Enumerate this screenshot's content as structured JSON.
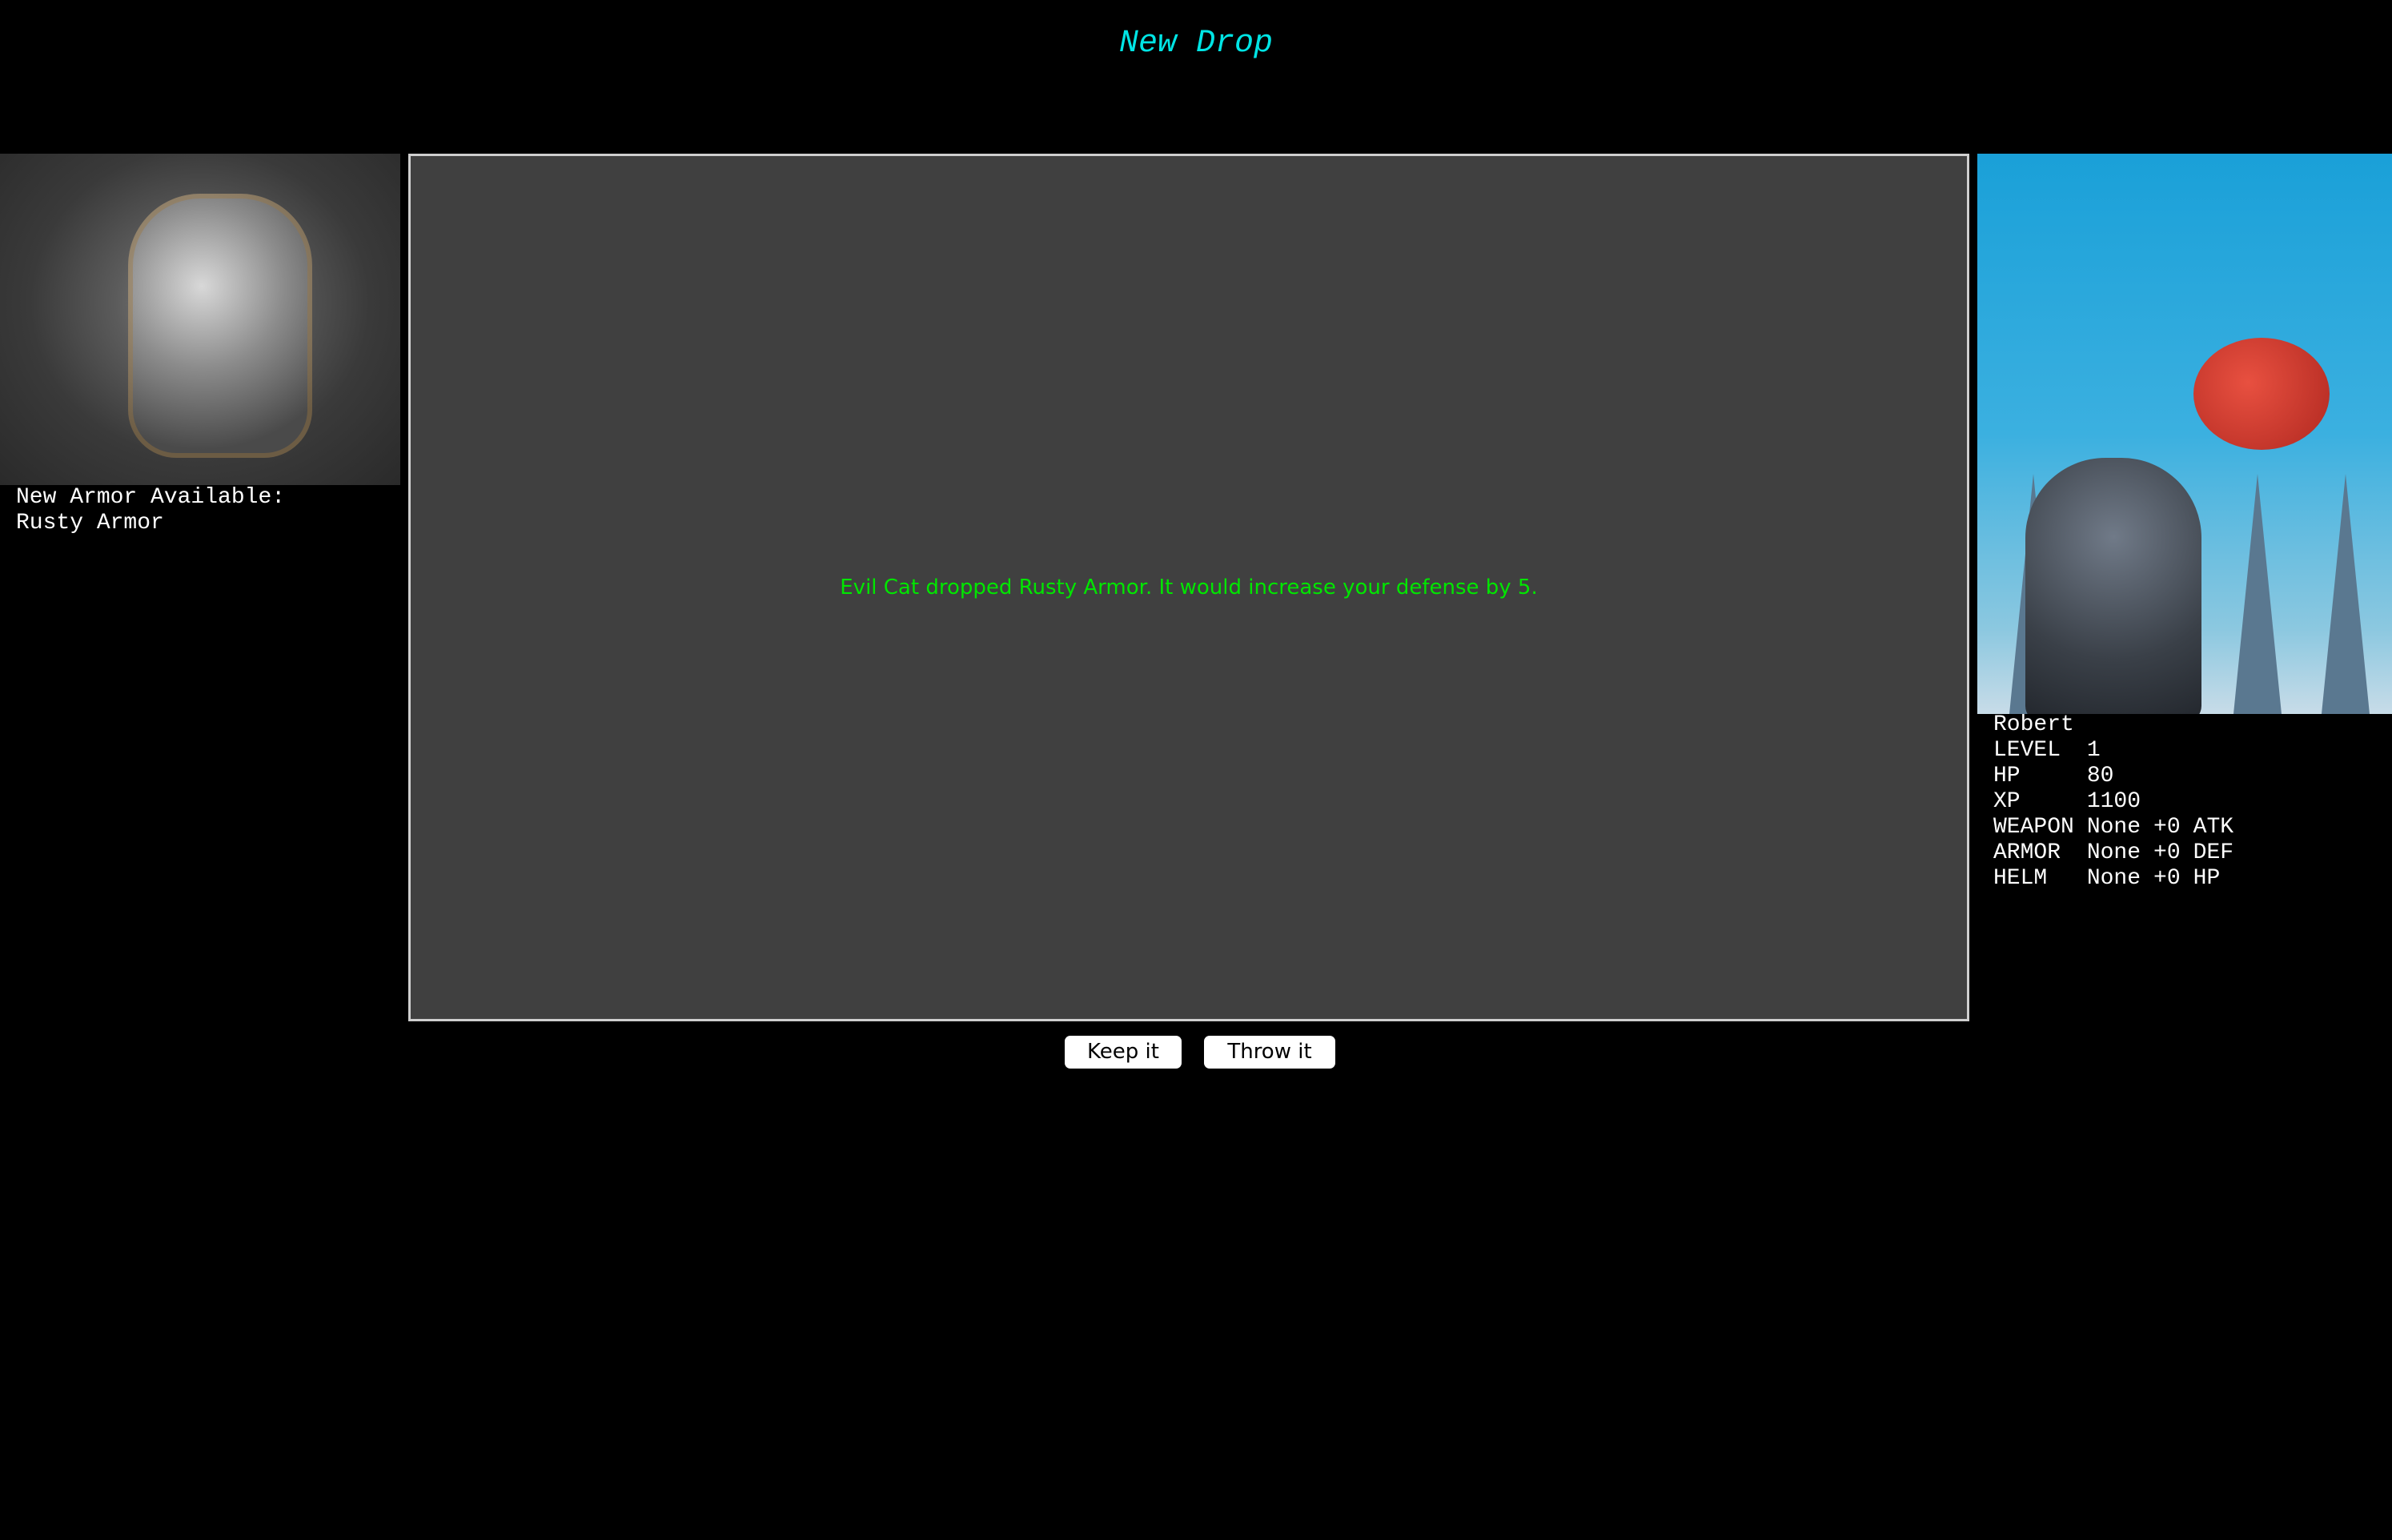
{
  "title": "New Drop",
  "item": {
    "heading": "New Armor Available:",
    "name": "Rusty Armor"
  },
  "message": "Evil Cat dropped Rusty Armor. It would increase your defense by 5.",
  "buttons": {
    "keep": "Keep it",
    "throw": "Throw it"
  },
  "hero": {
    "name": "Robert",
    "stats": [
      {
        "label": "LEVEL",
        "value": "1"
      },
      {
        "label": "HP",
        "value": "80"
      },
      {
        "label": "XP",
        "value": "1100"
      },
      {
        "label": "WEAPON",
        "value": "None",
        "bonus": "+0",
        "stat": "ATK"
      },
      {
        "label": "ARMOR",
        "value": "None",
        "bonus": "+0",
        "stat": "DEF"
      },
      {
        "label": "HELM",
        "value": "None",
        "bonus": "+0",
        "stat": "HP"
      }
    ]
  },
  "colors": {
    "title": "#00e5e5",
    "message": "#00e600",
    "panel": "#404040"
  }
}
